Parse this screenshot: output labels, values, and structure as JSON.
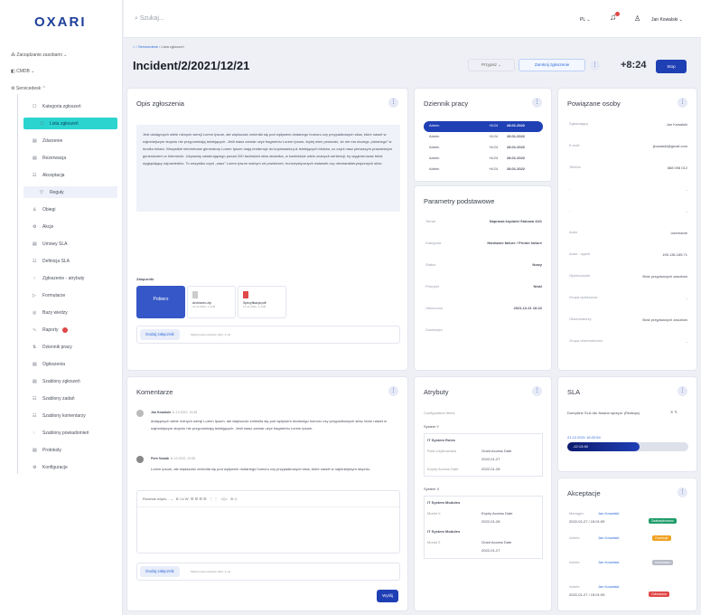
{
  "brand": "OXARI",
  "search": {
    "placeholder": "Szukaj..."
  },
  "topbar": {
    "lang": "PL",
    "user": "Jan Kowalski"
  },
  "sidebar": {
    "top": [
      "Zarządzanie zasobami",
      "CMDB",
      "Servicedesk"
    ],
    "items": [
      {
        "label": "Kategoria zgłoszeń",
        "ic": "☐"
      },
      {
        "label": "Lista zgłoszeń",
        "ic": "☐",
        "active": true,
        "sub": true
      },
      {
        "label": "Zdarzenie",
        "ic": "▤"
      },
      {
        "label": "Rezerwacja",
        "ic": "▤"
      },
      {
        "label": "Akceptacja",
        "ic": "☷"
      },
      {
        "label": "Reguły",
        "ic": "▽",
        "sub": true,
        "reg": true
      },
      {
        "label": "Obiegi",
        "ic": "♙"
      },
      {
        "label": "Akcje",
        "ic": "⚙"
      },
      {
        "label": "Umowy SLA",
        "ic": "▤"
      },
      {
        "label": "Definicja SLA",
        "ic": "☷"
      },
      {
        "label": "Zgłoszenie - atrybuty",
        "ic": "⁘"
      },
      {
        "label": "Formularze",
        "ic": "▷"
      },
      {
        "label": "Bazy wiedzy",
        "ic": "◎"
      },
      {
        "label": "Raporty",
        "ic": "∿",
        "badge": true
      },
      {
        "label": "Dziennik pracy",
        "ic": "⇅"
      },
      {
        "label": "Ogłoszenia",
        "ic": "▤"
      },
      {
        "label": "Szablony zgłoszeń",
        "ic": "▤"
      },
      {
        "label": "Szablony zadań",
        "ic": "☷"
      },
      {
        "label": "Szablony komentarzy",
        "ic": "☷"
      },
      {
        "label": "Szablony powiadomień",
        "ic": "◌"
      },
      {
        "label": "Protokoły",
        "ic": "▤"
      },
      {
        "label": "Konfiguracje",
        "ic": "⚙"
      }
    ]
  },
  "header": {
    "crumb1": "Servicedesk",
    "crumb2": "Lista zgłoszeń",
    "title": "Incident/2/2021/12/21",
    "przypisz": "Przypisz",
    "zamknij": "Zamknij zgłoszenie",
    "timer": "+8:24",
    "stop": "Stop"
  },
  "opis": {
    "title": "Opis zgłoszenia",
    "text": "Jest dostępnych wiele różnych wersji Lorem Ipsum, ale większość zmieniła się pod wpływem dodanego humoru czy przypadkowych słów, które nawet w najmniejszym stopniu nie przypominają istniejących. Jeśli masz zamiar użyć fragmentu Lorem Ipsum, lepiej mieć pewność, że nie ma niczego „dziwnego” w środku tekstu. Wszystkie internetowe generatory Lorem Ipsum mają tendencje do kopiowania już istniejących bloków, co czyni nasz pierwszym prawdziwym generatorem w Internecie. Używamy zawierającego ponad 200 łacińskich słów słownika, w kontekście wielu znanych sentencji, by wygenerować tekst wyglądający odpowiednio. To wszystko czyni „nasz” Lorem Ipsum wolnym od powtórzeń, humorystycznych wstawek czy niecharakterystycznych słów.",
    "att": "Załączniki",
    "files": [
      {
        "n": "Pobierz",
        "s": ""
      },
      {
        "n": "Archiwum.zip",
        "s": "12.11.2022, 1.4 kB"
      },
      {
        "n": "Specyfikacja.pdf",
        "s": "12.11.2022, 1.4 kB"
      }
    ],
    "add": "Dodaj załącznik",
    "max": "Maksymalna wielkość pliku: 4 mb"
  },
  "dziennik": {
    "title": "Dziennik pracy",
    "rows": [
      {
        "u": "Admin",
        "t": "+8:24",
        "d": "28.01.2022"
      },
      {
        "u": "Admin",
        "t": "+8:24",
        "d": "28.01.2022"
      },
      {
        "u": "Admin",
        "t": "+8:24",
        "d": "28.01.2022"
      },
      {
        "u": "Admin",
        "t": "+8:24",
        "d": "28.01.2022"
      },
      {
        "u": "Admin",
        "t": "+8:24",
        "d": "28.01.2022"
      }
    ]
  },
  "params": {
    "title": "Parametry podstawowe",
    "rows": [
      {
        "k": "Temat",
        "v": "Naprawa kopiarki Stalowa 44/1"
      },
      {
        "k": "Kategoria",
        "v": "Hardware failure / Printer failure"
      },
      {
        "k": "Status",
        "v": "Nowy"
      },
      {
        "k": "Priorytet",
        "v": "Niski"
      },
      {
        "k": "Utworzono",
        "v": "2021.12.21 16:22"
      },
      {
        "k": "Zamknięto",
        "v": ""
      }
    ]
  },
  "persons": {
    "title": "Powiązane osoby",
    "rows": [
      {
        "k": "Zgłaszający",
        "v": "Jan Kowalski"
      },
      {
        "k": "E-mail",
        "v": "jkowalski@gmail.com"
      },
      {
        "k": "Telefon",
        "v": "888 098 012"
      },
      {
        "k": "-",
        "v": "-"
      },
      {
        "k": "-",
        "v": "-"
      },
      {
        "k": "Autor",
        "v": "Username"
      },
      {
        "k": "Autor - agent",
        "v": "195.136.185.71"
      },
      {
        "k": "Opiekunowie",
        "v": "Brak przypisanych zasobów"
      },
      {
        "k": "Grupa opiekunów",
        "v": "-"
      },
      {
        "k": "Obserwatorzy",
        "v": "Brak przypisanych zasobów"
      },
      {
        "k": "Grupa obserwatorów",
        "v": "-"
      }
    ]
  },
  "komentarze": {
    "title": "Komentarze",
    "c1": {
      "u": "Jan Kowalski",
      "d": "11.10.2022, 14:38",
      "t": "dostępnych wiele różnych wersji Lorem Ipsum, ale większość zmieniła się pod wpływem dodanego humoru czy przypadkowych słów, które nawet w najmniejszym stopniu nie przypominają istniejących. Jeśli masz zamiar użyć fragmentu Lorem Ipsum."
    },
    "c2": {
      "u": "Piotr Nowak",
      "d": "11.10.2022, 10:55",
      "t": "Lorem ipsum, ale większość zmieniła się pod wpływem dodanego humoru czy przypadkowych słów, które nawet w najmniejszym stopniu."
    },
    "font": "Rozmiar edyto...",
    "add": "Dodaj załącznik",
    "max": "Maksymalna wielkość pliku: 4 mb",
    "send": "Wyślij"
  },
  "atrybuty": {
    "title": "Atrybuty",
    "cfg": "Configuration items",
    "sysY": "System Y",
    "g1": "IT System Roles",
    "k1": "Rola Użytkownika",
    "v1": "Grant Access Date",
    "v1b": "2022-01-27",
    "k2": "Expiry Access Date",
    "v2": "2022-01-28",
    "sysX": "System X",
    "g2": "IT System Modules",
    "k3": "Moduł X",
    "v3": "Expiry Access Date",
    "v3b": "2022-01-28",
    "g3": "IT System Modules",
    "k4": "Moduł Z",
    "v4": "Grant Access Date",
    "v4b": "2022-01-27"
  },
  "sla": {
    "title": "SLA",
    "name": "Domyślne SLA dla 'Awaria sprzętu' (Reakcja)",
    "date": "21.12.2021 16:22:54",
    "bar": "-12:13:40",
    "progress": 0.6
  },
  "akceptacje": {
    "title": "Akceptacje",
    "items": [
      {
        "role": "Manager:",
        "who": "Jan Kowalski",
        "d": "2022-01-27 / 15:01:09",
        "b": "Zaakceptowano",
        "c": "#1f9d6b"
      },
      {
        "role": "Admin:",
        "who": "Jan Kowalski",
        "b": "Oczekuje",
        "c": "#f0a020"
      },
      {
        "role": "Admin:",
        "who": "Jan Kowalski",
        "b": "Anulowano",
        "c": "#b8bcc6"
      },
      {
        "role": "Admin:",
        "who": "Jan Kowalski",
        "d": "2022-01-27 / 15:01:09",
        "b": "Odrzucono",
        "c": "#e04848"
      }
    ]
  }
}
